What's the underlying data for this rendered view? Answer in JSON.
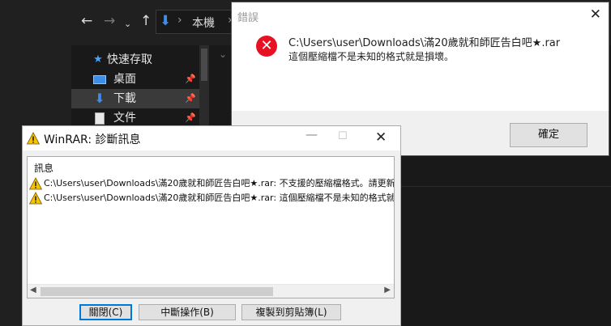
{
  "explorer": {
    "breadcrumb": "本機",
    "sidebar": {
      "quick_access": "快速存取",
      "items": [
        {
          "label": "桌面"
        },
        {
          "label": "下載"
        },
        {
          "label": "文件"
        }
      ]
    }
  },
  "error_dialog": {
    "title": "錯誤",
    "path": "C:\\Users\\user\\Downloads\\滿20歲就和師匠告白吧★.rar",
    "message": "這個壓縮檔不是未知的格式就是損壞。",
    "ok_label": "確定",
    "accent": "#e81123"
  },
  "winrar_dialog": {
    "title": "WinRAR: 診斷訊息",
    "header": "訊息",
    "messages": [
      "C:\\Users\\user\\Downloads\\滿20歲就和師匠告白吧★.rar: 不支援的壓縮檔格式。請更新",
      "C:\\Users\\user\\Downloads\\滿20歲就和師匠告白吧★.rar: 這個壓縮檔不是未知的格式就"
    ],
    "buttons": {
      "close": "關閉(C)",
      "break": "中斷操作(B)",
      "copy": "複製到剪貼簿(L)"
    },
    "scroll_thumb_fraction": 0.68
  }
}
